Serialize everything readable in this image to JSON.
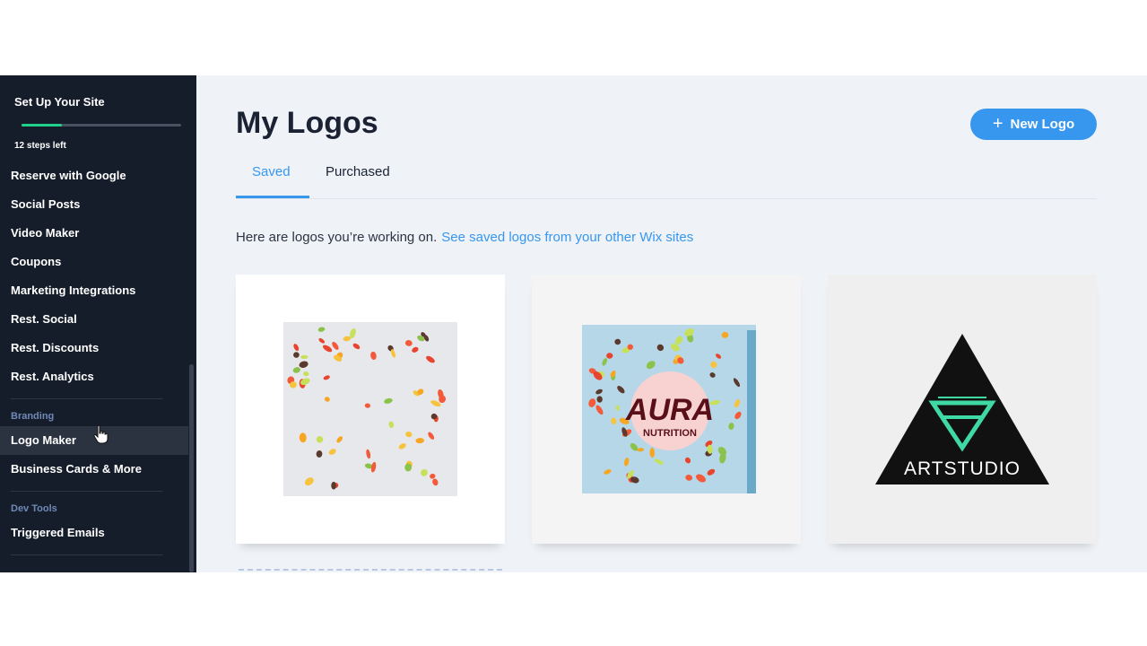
{
  "sidebar": {
    "setup": {
      "title": "Set Up Your Site",
      "progress": 0.25,
      "steps_left": "12 steps left"
    },
    "items": [
      {
        "label": "Reserve with Google"
      },
      {
        "label": "Social Posts"
      },
      {
        "label": "Video Maker"
      },
      {
        "label": "Coupons"
      },
      {
        "label": "Marketing Integrations"
      },
      {
        "label": "Rest. Social"
      },
      {
        "label": "Rest. Discounts"
      },
      {
        "label": "Rest. Analytics"
      }
    ],
    "branding": {
      "label": "Branding",
      "items": [
        {
          "label": "Logo Maker",
          "active": true
        },
        {
          "label": "Business Cards & More"
        }
      ]
    },
    "devtools": {
      "label": "Dev Tools",
      "items": [
        {
          "label": "Triggered Emails"
        }
      ]
    }
  },
  "main": {
    "title": "My Logos",
    "new_logo_label": "New Logo",
    "tabs": [
      {
        "label": "Saved",
        "active": true
      },
      {
        "label": "Purchased"
      }
    ],
    "intro_text": "Here are logos you’re working on.",
    "intro_link": "See saved logos from your other Wix sites",
    "logos": [
      {
        "name": "fruit-pattern-logo"
      },
      {
        "name": "aura-nutrition-logo",
        "line1": "AURA",
        "line2": "NUTRITION"
      },
      {
        "name": "artstudio-logo",
        "text": "ARTSTUDIO"
      }
    ]
  },
  "colors": {
    "sidebar_bg": "#161d2a",
    "accent": "#3797ef",
    "progress": "#1fd08b",
    "page_bg": "#eff2f7"
  }
}
